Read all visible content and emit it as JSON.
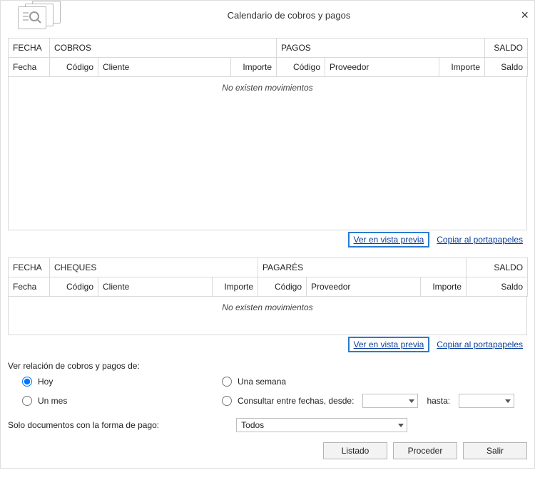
{
  "title": "Calendario de cobros y pagos",
  "close_glyph": "×",
  "table1": {
    "group_fecha": "FECHA",
    "group_cobros": "COBROS",
    "group_pagos": "PAGOS",
    "group_saldo": "SALDO",
    "col_fecha": "Fecha",
    "col_codigo_c": "Código",
    "col_cliente": "Cliente",
    "col_importe_c": "Importe",
    "col_codigo_p": "Código",
    "col_proveedor": "Proveedor",
    "col_importe_p": "Importe",
    "col_saldo": "Saldo",
    "empty_msg": "No existen movimientos"
  },
  "table2": {
    "group_fecha": "FECHA",
    "group_cheques": "CHEQUES",
    "group_pagares": "PAGARÉS",
    "group_saldo": "SALDO",
    "col_fecha": "Fecha",
    "col_codigo_c": "Código",
    "col_cliente": "Cliente",
    "col_importe_c": "Importe",
    "col_codigo_p": "Código",
    "col_proveedor": "Proveedor",
    "col_importe_p": "Importe",
    "col_saldo": "Saldo",
    "empty_msg": "No existen movimientos"
  },
  "links": {
    "preview": "Ver en vista previa",
    "copy": "Copiar al portapapeles"
  },
  "controls": {
    "title": "Ver relación de cobros y pagos de:",
    "hoy": "Hoy",
    "mes": "Un mes",
    "semana": "Una semana",
    "entre": "Consultar entre fechas, desde:",
    "hasta": "hasta:",
    "solo_forma": "Solo documentos con la forma de pago:",
    "forma_value": "Todos"
  },
  "buttons": {
    "listado": "Listado",
    "proceder": "Proceder",
    "salir": "Salir"
  }
}
